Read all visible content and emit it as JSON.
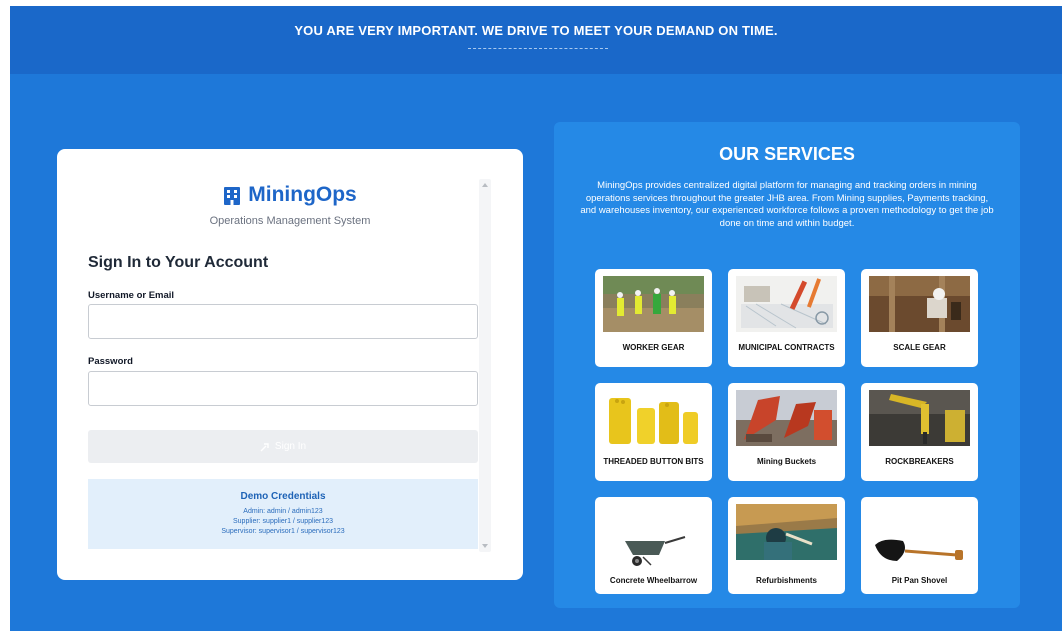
{
  "banner": {
    "title": "YOU ARE VERY IMPORTANT. WE DRIVE TO MEET YOUR DEMAND ON TIME."
  },
  "login": {
    "brand_name": "MiningOps",
    "brand_subtitle": "Operations Management System",
    "heading": "Sign In to Your Account",
    "username_label": "Username or Email",
    "username_value": "",
    "password_label": "Password",
    "password_value": "",
    "signin_label": "Sign In",
    "demo": {
      "title": "Demo Credentials",
      "lines": [
        "Admin: admin / admin123",
        "Supplier: supplier1 / supplier123",
        "Supervisor: supervisor1 / supervisor123"
      ]
    }
  },
  "services": {
    "title": "OUR SERVICES",
    "description": "MiningOps provides centralized digital platform for managing and tracking orders in mining operations services throughout the greater JHB area. From Mining supplies, Payments tracking, and warehouses inventory, our experienced workforce follows a proven methodology to get the job done on time and within budget.",
    "tiles": [
      {
        "label": "WORKER GEAR"
      },
      {
        "label": "MUNICIPAL CONTRACTS"
      },
      {
        "label": "SCALE GEAR"
      },
      {
        "label": "THREADED BUTTON BITS"
      },
      {
        "label": "Mining Buckets"
      },
      {
        "label": "ROCKBREAKERS"
      },
      {
        "label": "Concrete Wheelbarrow"
      },
      {
        "label": "Refurbishments"
      },
      {
        "label": "Pit Pan Shovel"
      }
    ]
  },
  "colors": {
    "page_blue": "#1e78d9",
    "banner_blue": "#1a68c9",
    "panel_blue": "#2589e6",
    "brand_blue": "#1e66c8",
    "demo_bg": "#e2effb"
  }
}
